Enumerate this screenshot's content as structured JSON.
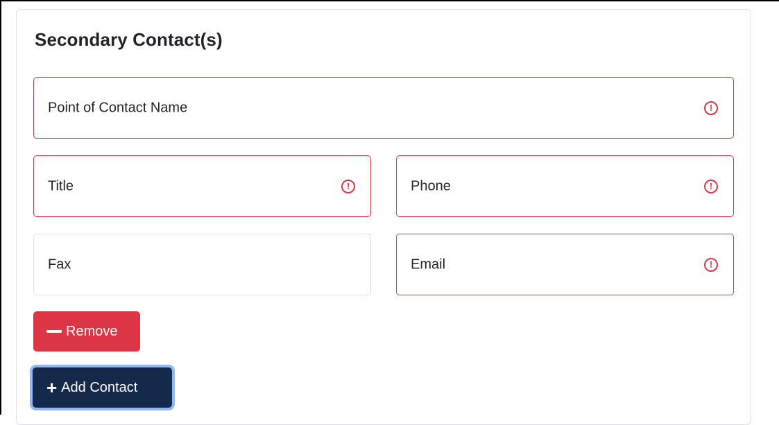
{
  "section": {
    "title": "Secondary Contact(s)"
  },
  "fields": {
    "poc_name": {
      "placeholder": "Point of Contact Name",
      "value": "",
      "invalid": true
    },
    "title": {
      "placeholder": "Title",
      "value": "",
      "invalid": true
    },
    "phone": {
      "placeholder": "Phone",
      "value": "",
      "invalid": true
    },
    "fax": {
      "placeholder": "Fax",
      "value": "",
      "invalid": false
    },
    "email": {
      "placeholder": "Email",
      "value": "",
      "invalid": true
    }
  },
  "buttons": {
    "remove_label": "Remove",
    "add_contact_label": "Add Contact",
    "remove_icon": "minus-icon",
    "add_icon": "plus-icon"
  },
  "colors": {
    "invalid_border": "#dc3545",
    "remove_bg": "#dc3545",
    "add_bg": "#152a4a",
    "focus_ring": "#8db8f2"
  }
}
